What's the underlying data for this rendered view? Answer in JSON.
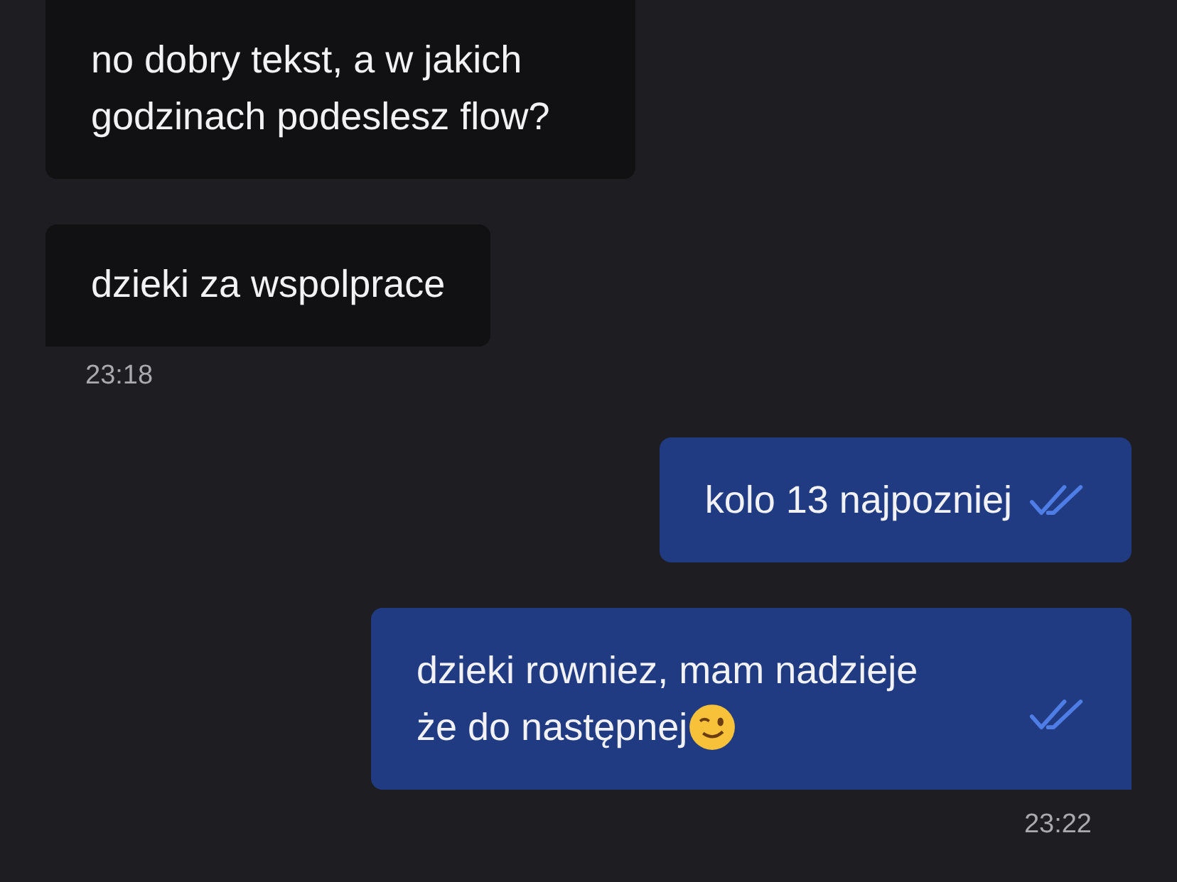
{
  "messages": [
    {
      "kind": "incoming",
      "lines": [
        [
          {
            "kind": "text",
            "text": "no dobry tekst, a w jakich"
          }
        ],
        [
          {
            "kind": "text",
            "text": "godzinach podeslesz flow?"
          }
        ]
      ],
      "tail": false
    },
    {
      "kind": "incoming",
      "lines": [
        [
          {
            "kind": "text",
            "text": "dzieki za wspolprace"
          }
        ]
      ],
      "tail": true
    },
    {
      "kind": "time-incoming",
      "text": "23:18"
    },
    {
      "kind": "outgoing",
      "lines": [
        [
          {
            "kind": "text",
            "text": "kolo 13 najpozniej"
          }
        ]
      ],
      "read": true,
      "tail": false
    },
    {
      "kind": "outgoing",
      "lines": [
        [
          {
            "kind": "text",
            "text": "dzieki rowniez, mam nadzieje"
          }
        ],
        [
          {
            "kind": "text",
            "text": "że do następnej"
          },
          {
            "kind": "wink-emoji"
          }
        ]
      ],
      "read": true,
      "tail": true
    },
    {
      "kind": "time-outgoing",
      "text": "23:22"
    }
  ]
}
